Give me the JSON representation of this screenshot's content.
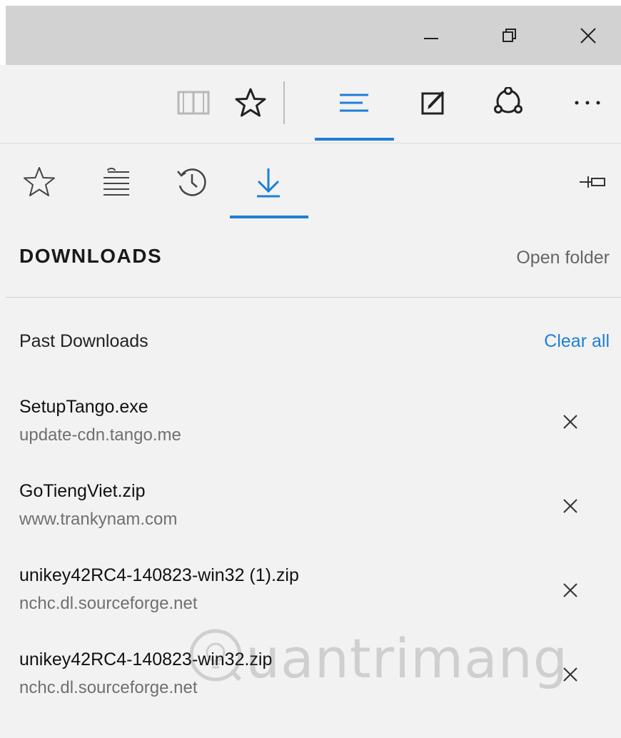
{
  "window": {
    "minimize_icon": "minimize-icon",
    "restore_icon": "restore-icon",
    "close_icon": "close-icon"
  },
  "toolbar": {
    "reading_view_icon": "book-icon",
    "favorites_icon": "star-icon",
    "hub_icon": "hub-icon",
    "web_note_icon": "pen-square-icon",
    "share_icon": "share-icon",
    "more_icon": "ellipsis-icon",
    "active": "hub",
    "accent_color": "#1e7fd6"
  },
  "hub": {
    "tabs": [
      {
        "id": "favorites",
        "icon": "star-icon"
      },
      {
        "id": "reading-list",
        "icon": "reading-list-icon"
      },
      {
        "id": "history",
        "icon": "history-icon"
      },
      {
        "id": "downloads",
        "icon": "download-icon"
      }
    ],
    "active_tab": "downloads",
    "pin_icon": "pin-icon",
    "title": "DOWNLOADS",
    "open_folder": "Open folder",
    "section_label": "Past Downloads",
    "clear_all": "Clear all",
    "items": [
      {
        "name": "SetupTango.exe",
        "source": "update-cdn.tango.me"
      },
      {
        "name": "GoTiengViet.zip",
        "source": "www.trankynam.com"
      },
      {
        "name": "unikey42RC4-140823-win32 (1).zip",
        "source": "nchc.dl.sourceforge.net"
      },
      {
        "name": "unikey42RC4-140823-win32.zip",
        "source": "nchc.dl.sourceforge.net"
      }
    ]
  },
  "watermark": {
    "text": "uantrimang"
  }
}
